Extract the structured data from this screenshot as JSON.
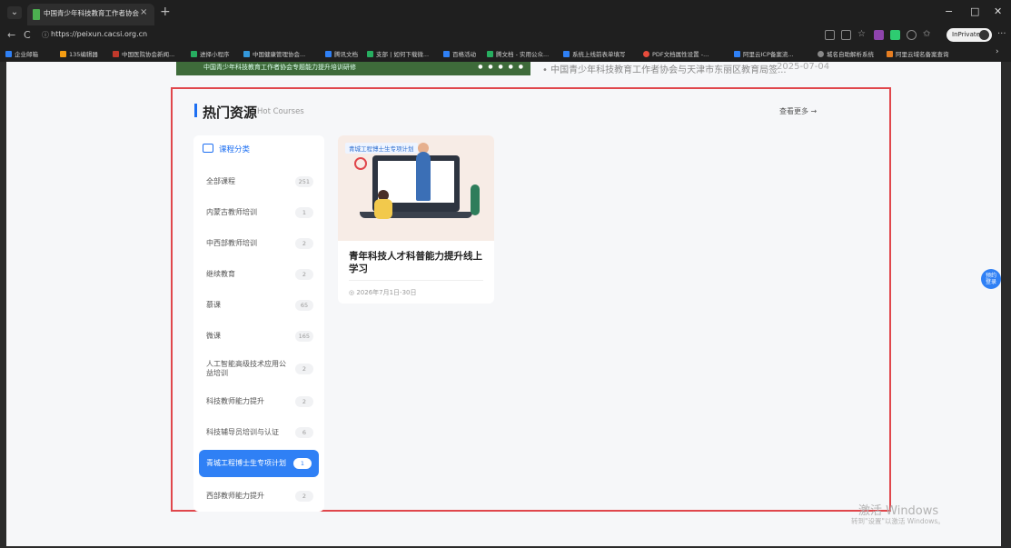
{
  "browser": {
    "tab_title": "中国青少年科技教育工作者协会",
    "tab_close": "×",
    "new_tab": "+",
    "url": "https://peixun.cacsi.org.cn",
    "inprivate_label": "InPrivate",
    "more": "···",
    "window_controls": {
      "minimize": "−",
      "restore": "□",
      "close": "✕"
    },
    "nav": {
      "back": "←",
      "refresh": "C"
    },
    "bookmarks": [
      "企业邮箱",
      "135编辑器",
      "中国医院协会新闻...",
      "进择小程序",
      "中国健康管理协会...",
      "腾讯文档",
      "支部 | 如何下载微...",
      "百格活动",
      "腾文档 - 实用公众...",
      "系统上线前表单填写",
      "PDF文档属性设置 -...",
      "阿里云ICP备案流...",
      "城名自助解析系统",
      "阿里云域名备案查询"
    ]
  },
  "top_strip": {
    "banner_text": "中国青少年科技教育工作者协会专题能力提升培训研修",
    "banner_dots": "● ● ● ● ●",
    "news_text": "• 中国青少年科技教育工作者协会与天津市东丽区教育局签...",
    "news_date": "2025-07-04"
  },
  "section": {
    "title": "热门资源",
    "subtitle": "Hot Courses",
    "more_link": "查看更多 →"
  },
  "sidebar": {
    "header": "课程分类",
    "items": [
      {
        "label": "全部课程",
        "count": "251"
      },
      {
        "label": "内蒙古教师培训",
        "count": "1"
      },
      {
        "label": "中西部教师培训",
        "count": "2"
      },
      {
        "label": "继续教育",
        "count": "2"
      },
      {
        "label": "慕课",
        "count": "65"
      },
      {
        "label": "微课",
        "count": "165"
      },
      {
        "label": "人工智能高级技术应用公益培训",
        "count": "2"
      },
      {
        "label": "科技教师能力提升",
        "count": "2"
      },
      {
        "label": "科技辅导员培训与认证",
        "count": "6"
      },
      {
        "label": "青城工程博士生专项计划",
        "count": "1"
      },
      {
        "label": "西部教师能力提升",
        "count": "2"
      }
    ],
    "active_index": 9
  },
  "course_card": {
    "tag": "青城工程博士生专项计划",
    "title": "青年科技人才科普能力提升线上学习",
    "date": "◎ 2026年7月1日-30日"
  },
  "float_button": {
    "line1": "预约",
    "line2": "登录"
  },
  "watermark": {
    "title": "激活 Windows",
    "subtitle": "转到\"设置\"以激活 Windows。"
  },
  "colors": {
    "accent": "#2f80f5",
    "highlight_border": "#e0474c"
  }
}
